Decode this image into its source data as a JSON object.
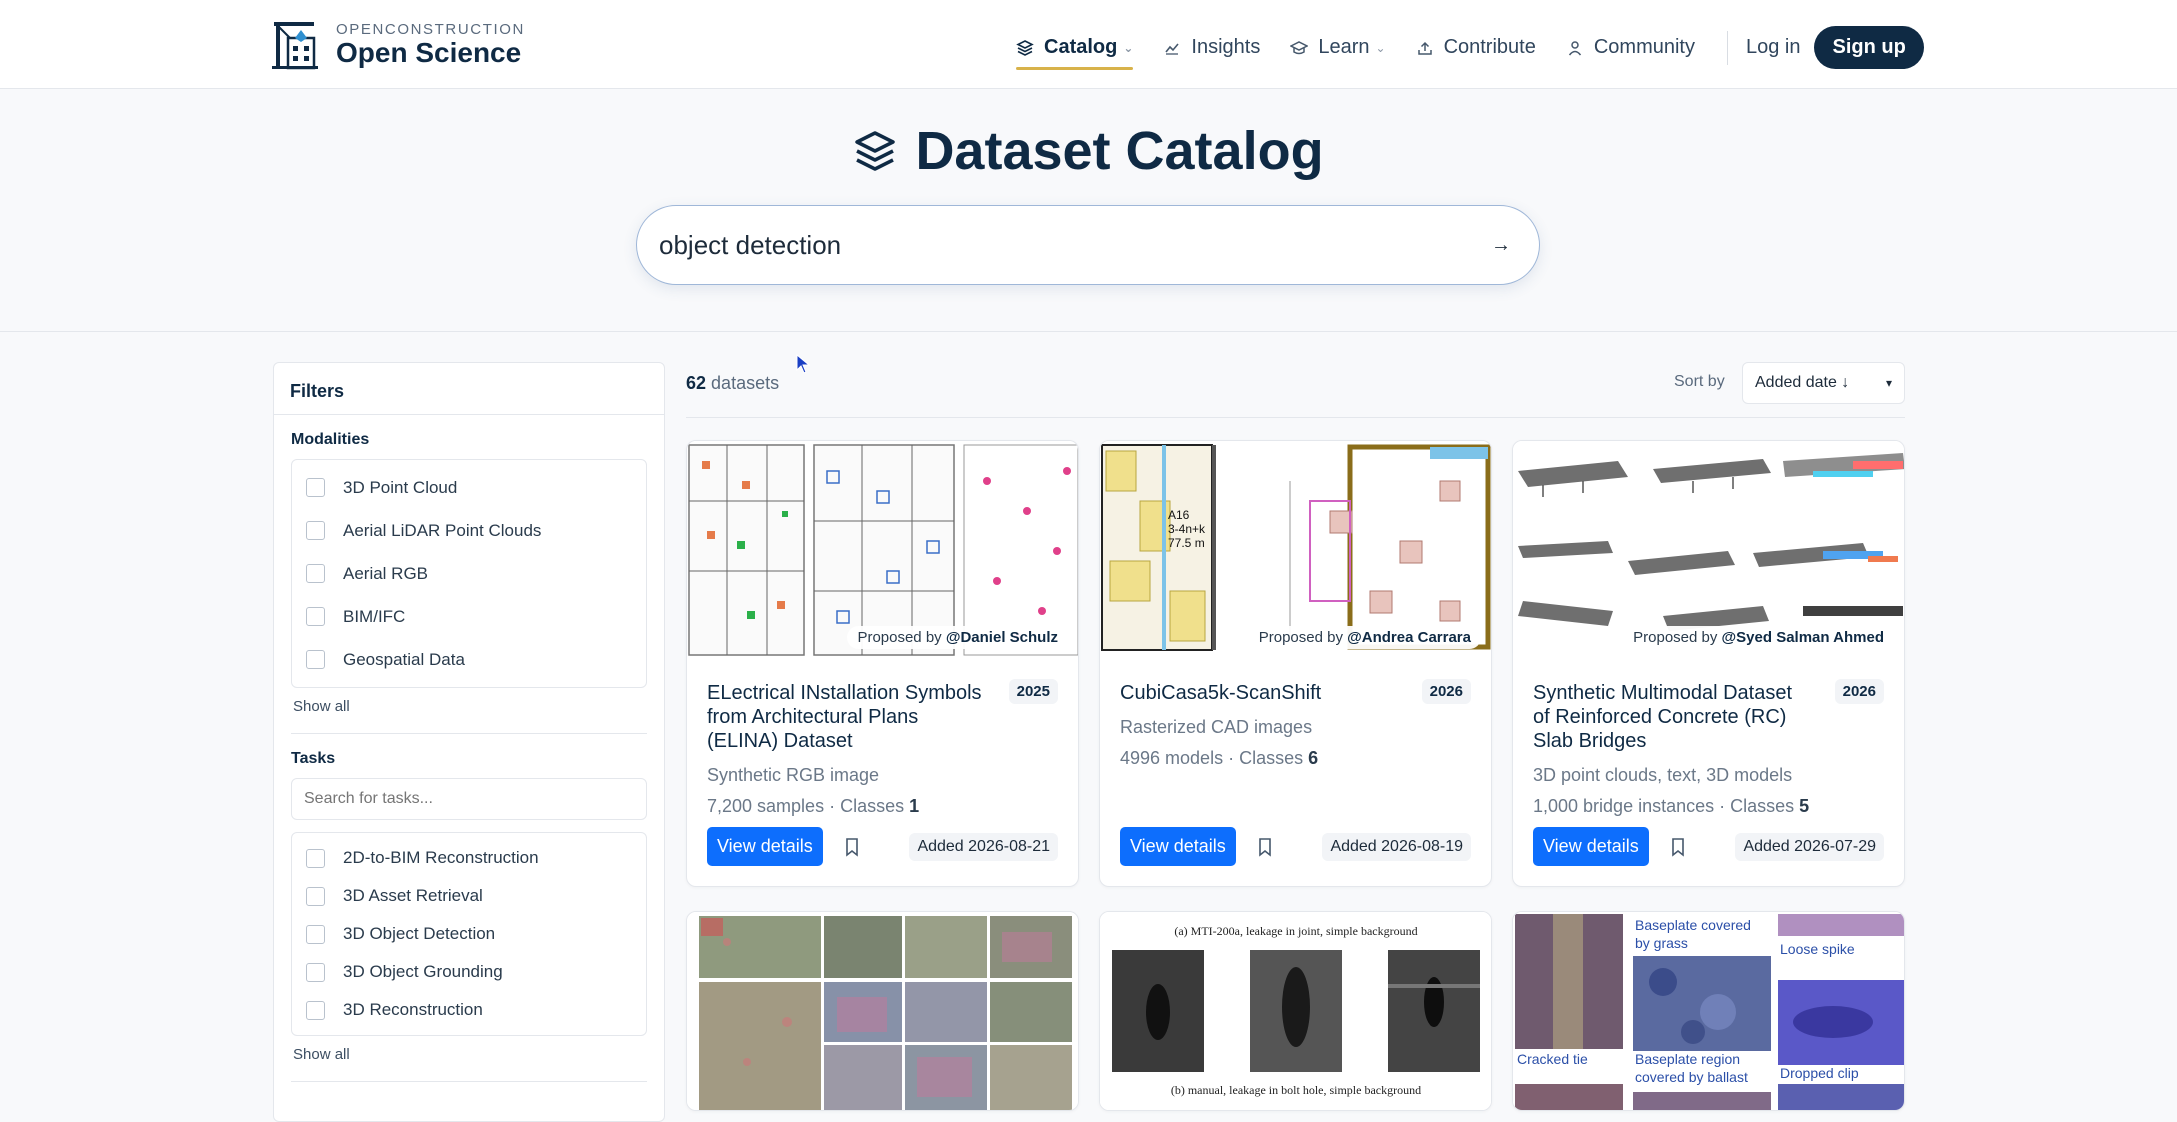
{
  "brand": {
    "sub": "OPENCONSTRUCTION",
    "name": "Open Science"
  },
  "nav": [
    {
      "label": "Catalog",
      "icon": "layers-icon",
      "dropdown": true,
      "active": true
    },
    {
      "label": "Insights",
      "icon": "chart-line-icon",
      "dropdown": false
    },
    {
      "label": "Learn",
      "icon": "graduation-cap-icon",
      "dropdown": true
    },
    {
      "label": "Contribute",
      "icon": "upload-icon",
      "dropdown": false
    },
    {
      "label": "Community",
      "icon": "user-icon",
      "dropdown": false
    }
  ],
  "auth": {
    "login": "Log in",
    "signup": "Sign up"
  },
  "hero": {
    "title": "Dataset Catalog"
  },
  "search": {
    "value": "object detection"
  },
  "filters": {
    "title": "Filters",
    "modalities": {
      "title": "Modalities",
      "options": [
        "3D Point Cloud",
        "Aerial LiDAR Point Clouds",
        "Aerial RGB",
        "BIM/IFC",
        "Geospatial Data"
      ],
      "show_all": "Show all"
    },
    "tasks": {
      "title": "Tasks",
      "search_placeholder": "Search for tasks...",
      "options": [
        "2D-to-BIM Reconstruction",
        "3D Asset Retrieval",
        "3D Object Detection",
        "3D Object Grounding",
        "3D Reconstruction"
      ],
      "show_all": "Show all"
    }
  },
  "results": {
    "count": "62",
    "count_label": "datasets",
    "sort_label": "Sort by",
    "sort_value": "Added date ↓"
  },
  "cards": [
    {
      "proposed_prefix": "Proposed by",
      "proposer": "@Daniel Schulz",
      "title": "ELectrical INstallation Symbols from Architectural Plans (ELINA) Dataset",
      "year": "2025",
      "modality": "Synthetic RGB image",
      "meta_prefix": "7,200 samples · Classes",
      "classes": "1",
      "view": "View details",
      "added": "Added 2026-08-21"
    },
    {
      "proposed_prefix": "Proposed by",
      "proposer": "@Andrea Carrara",
      "title": "CubiCasa5k-ScanShift",
      "year": "2026",
      "modality": "Rasterized CAD images",
      "meta_prefix": "4996 models · Classes",
      "classes": "6",
      "view": "View details",
      "added": "Added 2026-08-19",
      "thumb_label": "A16\n3-4n+k\n77.5 m"
    },
    {
      "proposed_prefix": "Proposed by",
      "proposer": "@Syed Salman Ahmed",
      "title": "Synthetic Multimodal Dataset of Reinforced Concrete (RC) Slab Bridges",
      "year": "2026",
      "modality": "3D point clouds, text, 3D models",
      "meta_prefix": "1,000 bridge instances · Classes",
      "classes": "5",
      "view": "View details",
      "added": "Added 2026-07-29"
    },
    {
      "thumb": "aerial-imagery"
    },
    {
      "thumb": "leakage-photos",
      "caption_top": "(a) MTI-200a, leakage in joint, simple background",
      "caption_bottom": "(b) manual, leakage in bolt hole, simple background"
    },
    {
      "thumb": "railway-defects",
      "labels": [
        "Baseplate covered by grass",
        "Loose spike",
        "Cracked tie",
        "Baseplate region covered by ballast",
        "Dropped clip"
      ]
    }
  ]
}
